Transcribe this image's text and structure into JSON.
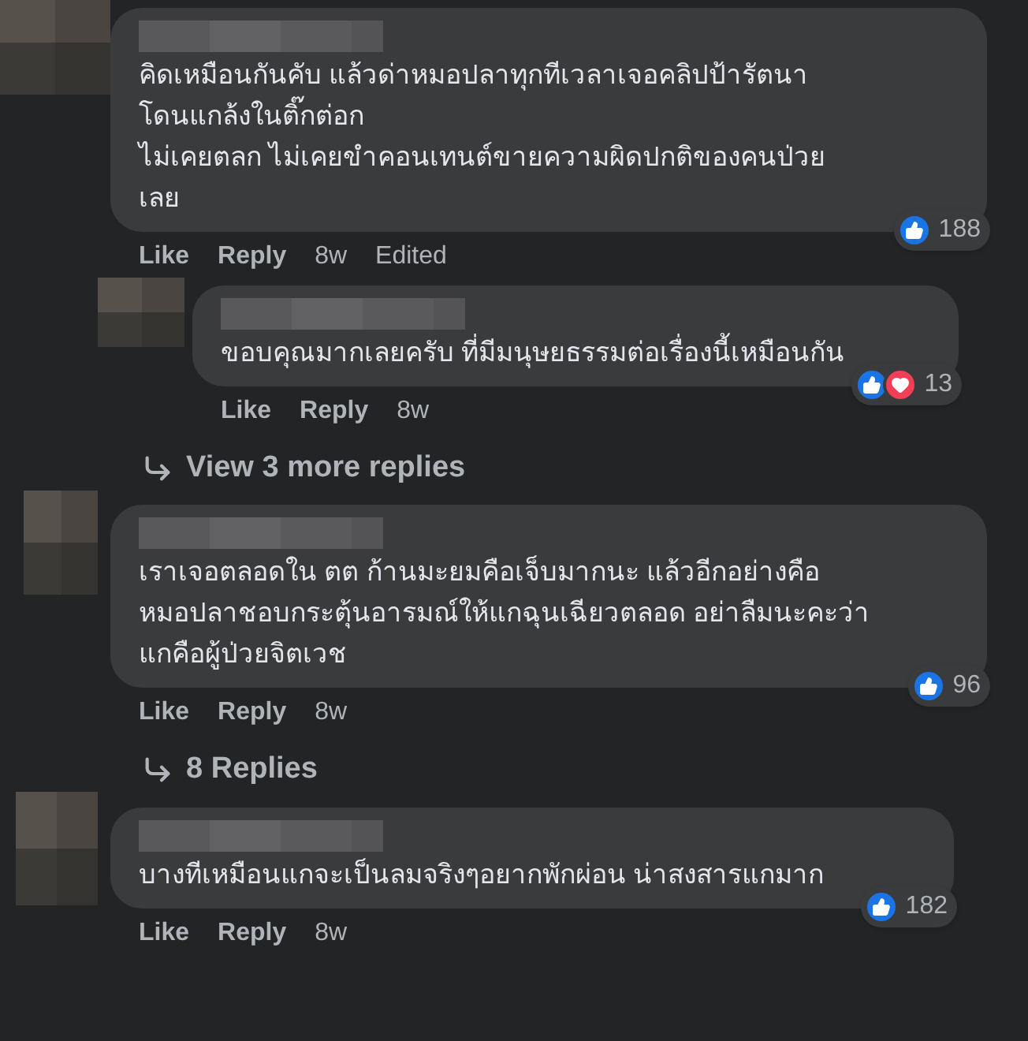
{
  "comments": [
    {
      "lines": [
        "คิดเหมือนกันคับ แล้วด่าหมอปลาทุกทีเวลาเจอคลิปป้ารัตนา",
        "โดนแกล้งในติ๊กต่อก",
        "ไม่เคยตลก ไม่เคยขำคอนเทนต์ขายความผิดปกติของคนป่วย",
        "เลย"
      ],
      "reactions": [
        {
          "kind": "like"
        }
      ],
      "count": "188",
      "actions": [
        "Like",
        "Reply"
      ],
      "time": "8w",
      "edited": "Edited",
      "replies": [
        {
          "lines": [
            "ขอบคุณมากเลยครับ ที่มีมนุษยธรรมต่อเรื่องนี้เหมือนกัน"
          ],
          "reactions": [
            {
              "kind": "like"
            },
            {
              "kind": "love"
            }
          ],
          "count": "13",
          "actions": [
            "Like",
            "Reply"
          ],
          "time": "8w"
        }
      ],
      "more_replies": "View 3 more replies"
    },
    {
      "lines": [
        "เราเจอตลอดใน ตต ก้านมะยมคือเจ็บมากนะ แล้วอีกอย่างคือ",
        "หมอปลาชอบกระตุ้นอารมณ์ให้แกฉุนเฉียวตลอด อย่าลืมนะคะว่า",
        "แกคือผู้ป่วยจิตเวช"
      ],
      "reactions": [
        {
          "kind": "like"
        }
      ],
      "count": "96",
      "actions": [
        "Like",
        "Reply"
      ],
      "time": "8w",
      "more_replies": "8 Replies"
    },
    {
      "lines": [
        "บางทีเหมือนแกจะเป็นลมจริงๆอยากพักผ่อน น่าสงสารแกมาก"
      ],
      "reactions": [
        {
          "kind": "like"
        }
      ],
      "count": "182",
      "actions": [
        "Like",
        "Reply"
      ],
      "time": "8w"
    }
  ]
}
